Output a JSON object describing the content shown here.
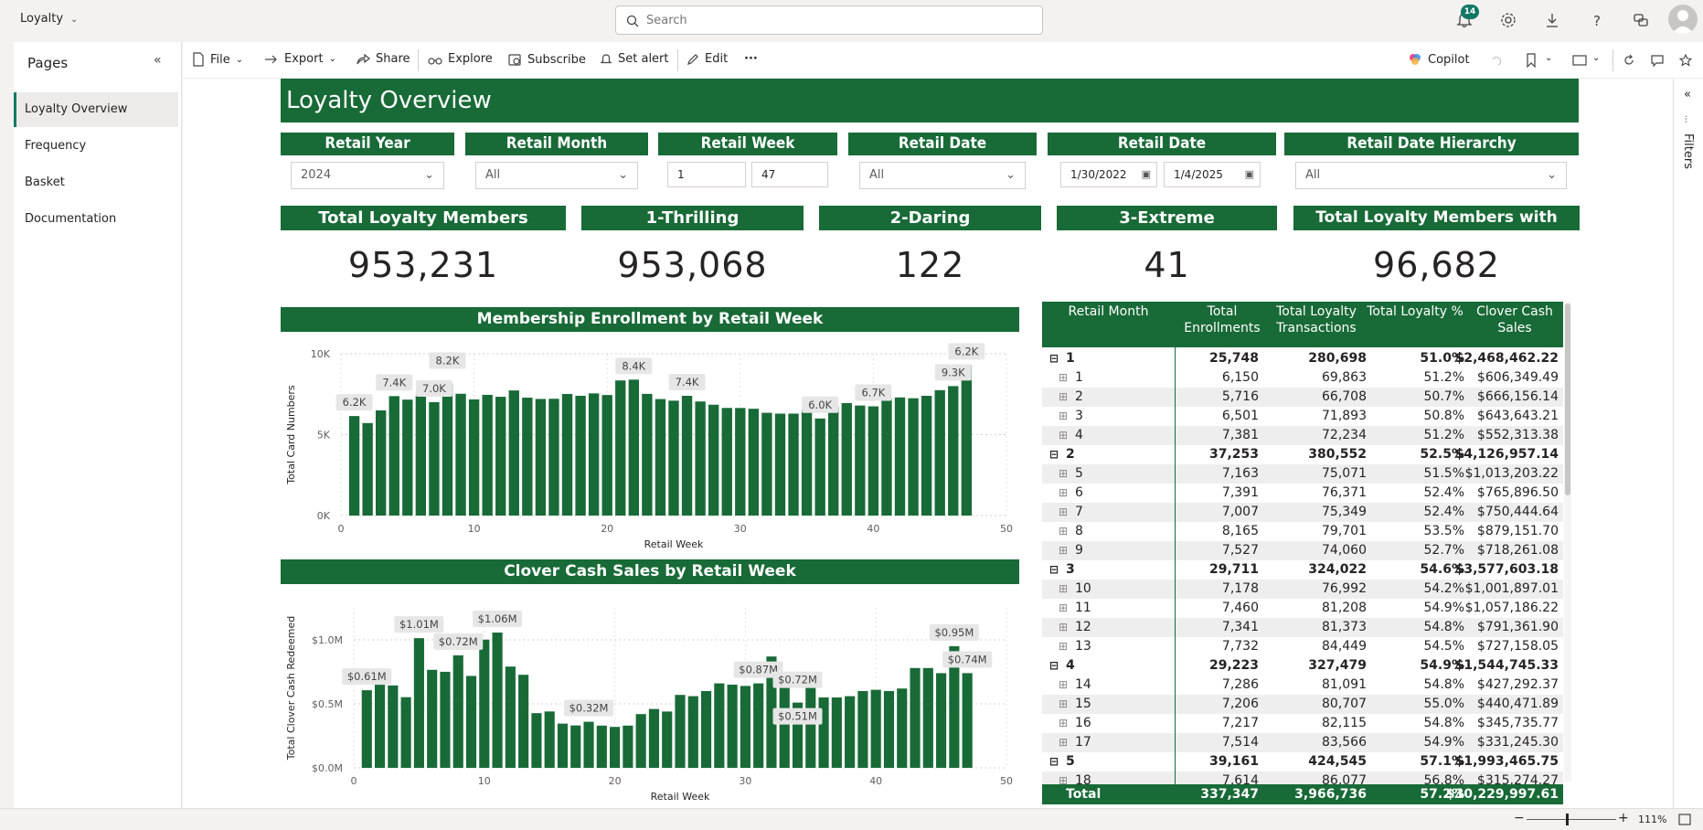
{
  "app": {
    "name": "Loyalty"
  },
  "search": {
    "placeholder": "Search"
  },
  "notifications": {
    "count": "14"
  },
  "sidebar": {
    "title": "Pages",
    "items": [
      {
        "label": "Loyalty Overview",
        "active": true
      },
      {
        "label": "Frequency",
        "active": false
      },
      {
        "label": "Basket",
        "active": false
      },
      {
        "label": "Documentation",
        "active": false
      }
    ]
  },
  "toolbar": {
    "file": "File",
    "export": "Export",
    "share": "Share",
    "explore": "Explore",
    "subscribe": "Subscribe",
    "set_alert": "Set alert",
    "edit": "Edit",
    "more": "···",
    "copilot": "Copilot"
  },
  "filters_pane": {
    "label": "Filters"
  },
  "report": {
    "title": "Loyalty Overview",
    "slicers": {
      "retail_year": {
        "label": "Retail Year",
        "value": "2024"
      },
      "retail_month": {
        "label": "Retail Month",
        "value": "All"
      },
      "retail_week": {
        "label": "Retail Week",
        "from": "1",
        "to": "47"
      },
      "retail_date": {
        "label": "Retail Date",
        "value": "All"
      },
      "retail_date_range": {
        "label": "Retail Date",
        "from": "1/30/2022",
        "to": "1/4/2025"
      },
      "retail_date_hierarchy": {
        "label": "Retail Date Hierarchy",
        "value": "All"
      }
    },
    "kpis": [
      {
        "label": "Total Loyalty Members",
        "value": "953,231"
      },
      {
        "label": "1-Thrilling",
        "value": "953,068"
      },
      {
        "label": "2-Daring",
        "value": "122"
      },
      {
        "label": "3-Extreme",
        "value": "41"
      },
      {
        "label": "Total Loyalty Members with Email",
        "value": "96,682"
      }
    ]
  },
  "chart_data": [
    {
      "type": "bar",
      "title": "Membership Enrollment by Retail Week",
      "xlabel": "Retail Week",
      "ylabel": "Total Card Numbers",
      "xlim": [
        0,
        50
      ],
      "ylim": [
        0,
        10000
      ],
      "xticks": [
        "0",
        "10",
        "20",
        "30",
        "40",
        "50"
      ],
      "yticks": [
        "0K",
        "5K",
        "10K"
      ],
      "grid": true,
      "color": "#186a37",
      "x": [
        1,
        2,
        3,
        4,
        5,
        6,
        7,
        8,
        9,
        10,
        11,
        12,
        13,
        14,
        15,
        16,
        17,
        18,
        19,
        20,
        21,
        22,
        23,
        24,
        25,
        26,
        27,
        28,
        29,
        30,
        31,
        32,
        33,
        34,
        35,
        36,
        37,
        38,
        39,
        40,
        41,
        42,
        43,
        44,
        45,
        46,
        47
      ],
      "values": [
        6150,
        5716,
        6501,
        7381,
        7163,
        7391,
        7007,
        8165,
        7527,
        7178,
        7460,
        7341,
        7732,
        7286,
        7206,
        7217,
        7514,
        7400,
        7550,
        7450,
        8350,
        8400,
        7520,
        7200,
        7100,
        7400,
        7050,
        6850,
        6650,
        6650,
        6600,
        6350,
        6300,
        6300,
        6550,
        6000,
        6750,
        6950,
        6800,
        6750,
        7250,
        7300,
        7250,
        7400,
        7750,
        8000,
        9300,
        6150
      ],
      "data_labels": [
        {
          "x": 1,
          "text": "6.2K"
        },
        {
          "x": 4,
          "text": "7.4K"
        },
        {
          "x": 7,
          "text": "7.0K"
        },
        {
          "x": 8,
          "text": "8.2K"
        },
        {
          "x": 22,
          "text": "8.4K"
        },
        {
          "x": 26,
          "text": "7.4K"
        },
        {
          "x": 36,
          "text": "6.0K"
        },
        {
          "x": 40,
          "text": "6.7K"
        },
        {
          "x": 46,
          "text": "9.3K"
        },
        {
          "x": 47,
          "text": "6.2K"
        }
      ]
    },
    {
      "type": "bar",
      "title": "Clover Cash Sales by Retail Week",
      "xlabel": "Retail Week",
      "ylabel": "Total Clover Cash Redeemed",
      "xlim": [
        0,
        50
      ],
      "ylim": [
        0,
        1250000
      ],
      "xticks": [
        "0",
        "10",
        "20",
        "30",
        "40",
        "50"
      ],
      "yticks": [
        "$0.0M",
        "$0.5M",
        "$1.0M"
      ],
      "grid": true,
      "color": "#186a37",
      "x": [
        1,
        2,
        3,
        4,
        5,
        6,
        7,
        8,
        9,
        10,
        11,
        12,
        13,
        14,
        15,
        16,
        17,
        18,
        19,
        20,
        21,
        22,
        23,
        24,
        25,
        26,
        27,
        28,
        29,
        30,
        31,
        32,
        33,
        34,
        35,
        36,
        37,
        38,
        39,
        40,
        41,
        42,
        43,
        44,
        45,
        46,
        47
      ],
      "values": [
        606349,
        666156,
        643643,
        552314,
        1013203,
        765896,
        750445,
        879152,
        718261,
        1001897,
        1057186,
        791362,
        727158,
        427292,
        440472,
        345736,
        331245,
        360000,
        330000,
        320000,
        330000,
        420000,
        460000,
        440000,
        570000,
        560000,
        600000,
        660000,
        650000,
        640000,
        660000,
        870000,
        720000,
        510000,
        720000,
        550000,
        550000,
        560000,
        600000,
        610000,
        600000,
        620000,
        780000,
        780000,
        740000,
        950000,
        740000
      ],
      "data_labels": [
        {
          "x": 1,
          "text": "$0.61M"
        },
        {
          "x": 5,
          "text": "$1.01M"
        },
        {
          "x": 8,
          "text": "$0.72M"
        },
        {
          "x": 11,
          "text": "$1.06M"
        },
        {
          "x": 18,
          "text": "$0.32M"
        },
        {
          "x": 31,
          "text": "$0.87M"
        },
        {
          "x": 34,
          "text": "$0.51M"
        },
        {
          "x": 34,
          "text": "$0.72M"
        },
        {
          "x": 46,
          "text": "$0.95M"
        },
        {
          "x": 47,
          "text": "$0.74M"
        }
      ]
    },
    {
      "type": "table",
      "columns": [
        "Retail Month",
        "Total Enrollments",
        "Total Loyalty Transactions",
        "Total Loyalty %",
        "Clover Cash Sales"
      ],
      "rows": [
        {
          "level": 0,
          "key": "1",
          "enroll": "25,748",
          "trans": "280,698",
          "pct": "51.0%",
          "sales": "$2,468,462.22"
        },
        {
          "level": 1,
          "key": "1",
          "enroll": "6,150",
          "trans": "69,863",
          "pct": "51.2%",
          "sales": "$606,349.49"
        },
        {
          "level": 1,
          "key": "2",
          "enroll": "5,716",
          "trans": "66,708",
          "pct": "50.7%",
          "sales": "$666,156.14"
        },
        {
          "level": 1,
          "key": "3",
          "enroll": "6,501",
          "trans": "71,893",
          "pct": "50.8%",
          "sales": "$643,643.21"
        },
        {
          "level": 1,
          "key": "4",
          "enroll": "7,381",
          "trans": "72,234",
          "pct": "51.2%",
          "sales": "$552,313.38"
        },
        {
          "level": 0,
          "key": "2",
          "enroll": "37,253",
          "trans": "380,552",
          "pct": "52.5%",
          "sales": "$4,126,957.14"
        },
        {
          "level": 1,
          "key": "5",
          "enroll": "7,163",
          "trans": "75,071",
          "pct": "51.5%",
          "sales": "$1,013,203.22"
        },
        {
          "level": 1,
          "key": "6",
          "enroll": "7,391",
          "trans": "76,371",
          "pct": "52.4%",
          "sales": "$765,896.50"
        },
        {
          "level": 1,
          "key": "7",
          "enroll": "7,007",
          "trans": "75,349",
          "pct": "52.4%",
          "sales": "$750,444.64"
        },
        {
          "level": 1,
          "key": "8",
          "enroll": "8,165",
          "trans": "79,701",
          "pct": "53.5%",
          "sales": "$879,151.70"
        },
        {
          "level": 1,
          "key": "9",
          "enroll": "7,527",
          "trans": "74,060",
          "pct": "52.7%",
          "sales": "$718,261.08"
        },
        {
          "level": 0,
          "key": "3",
          "enroll": "29,711",
          "trans": "324,022",
          "pct": "54.6%",
          "sales": "$3,577,603.18"
        },
        {
          "level": 1,
          "key": "10",
          "enroll": "7,178",
          "trans": "76,992",
          "pct": "54.2%",
          "sales": "$1,001,897.01"
        },
        {
          "level": 1,
          "key": "11",
          "enroll": "7,460",
          "trans": "81,208",
          "pct": "54.9%",
          "sales": "$1,057,186.22"
        },
        {
          "level": 1,
          "key": "12",
          "enroll": "7,341",
          "trans": "81,373",
          "pct": "54.8%",
          "sales": "$791,361.90"
        },
        {
          "level": 1,
          "key": "13",
          "enroll": "7,732",
          "trans": "84,449",
          "pct": "54.5%",
          "sales": "$727,158.05"
        },
        {
          "level": 0,
          "key": "4",
          "enroll": "29,223",
          "trans": "327,479",
          "pct": "54.9%",
          "sales": "$1,544,745.33"
        },
        {
          "level": 1,
          "key": "14",
          "enroll": "7,286",
          "trans": "81,091",
          "pct": "54.8%",
          "sales": "$427,292.37"
        },
        {
          "level": 1,
          "key": "15",
          "enroll": "7,206",
          "trans": "80,707",
          "pct": "55.0%",
          "sales": "$440,471.89"
        },
        {
          "level": 1,
          "key": "16",
          "enroll": "7,217",
          "trans": "82,115",
          "pct": "54.8%",
          "sales": "$345,735.77"
        },
        {
          "level": 1,
          "key": "17",
          "enroll": "7,514",
          "trans": "83,566",
          "pct": "54.9%",
          "sales": "$331,245.30"
        },
        {
          "level": 0,
          "key": "5",
          "enroll": "39,161",
          "trans": "424,545",
          "pct": "57.1%",
          "sales": "$1,993,465.75"
        },
        {
          "level": 1,
          "key": "18",
          "enroll": "7,614",
          "trans": "86,077",
          "pct": "56.8%",
          "sales": "$315,274.27"
        }
      ],
      "total": {
        "label": "Total",
        "enroll": "337,347",
        "trans": "3,966,736",
        "pct": "57.2%",
        "sales": "$30,229,997.61"
      }
    }
  ],
  "status": {
    "zoom": "111%"
  }
}
